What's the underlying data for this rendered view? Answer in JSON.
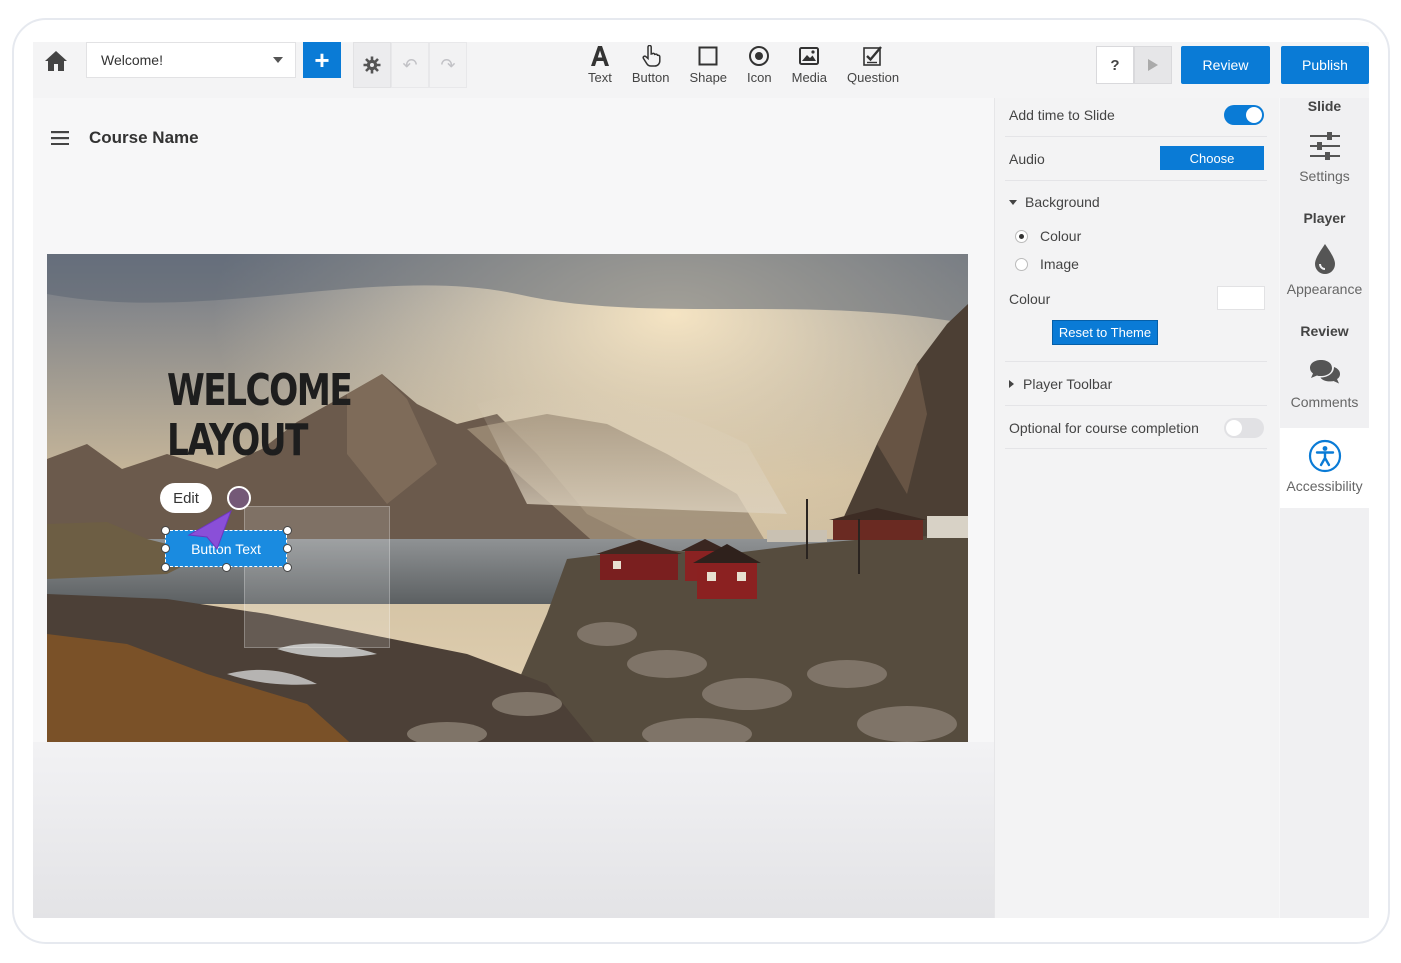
{
  "toolbar": {
    "slide_select_value": "Welcome!",
    "add_label": "+",
    "help_label": "?",
    "insert_tools": [
      {
        "label": "Text",
        "icon": "text-icon"
      },
      {
        "label": "Button",
        "icon": "hand-pointer-icon"
      },
      {
        "label": "Shape",
        "icon": "square-icon"
      },
      {
        "label": "Icon",
        "icon": "target-icon"
      },
      {
        "label": "Media",
        "icon": "image-icon"
      },
      {
        "label": "Question",
        "icon": "checklist-icon"
      }
    ],
    "review_label": "Review",
    "publish_label": "Publish"
  },
  "course": {
    "name": "Course Name"
  },
  "slide": {
    "title_line1": "WELCOME",
    "title_line2": "LAYOUT",
    "edit_label": "Edit",
    "button_text": "Button Text"
  },
  "properties": {
    "add_time_label": "Add time to Slide",
    "add_time_enabled": true,
    "audio_label": "Audio",
    "choose_label": "Choose",
    "background_label": "Background",
    "bg_options": [
      {
        "label": "Colour",
        "checked": true
      },
      {
        "label": "Image",
        "checked": false
      }
    ],
    "colour_label": "Colour",
    "colour_value": "#ffffff",
    "reset_label": "Reset to Theme",
    "player_toolbar_label": "Player Toolbar",
    "optional_label": "Optional for course completion",
    "optional_enabled": false
  },
  "sidebar": {
    "slide_heading": "Slide",
    "settings_label": "Settings",
    "player_heading": "Player",
    "appearance_label": "Appearance",
    "review_heading": "Review",
    "comments_label": "Comments",
    "accessibility_label": "Accessibility"
  },
  "colors": {
    "accent": "#0a7bd6",
    "slide_button": "#1a8be0",
    "cursor": "#8a4fd8"
  }
}
